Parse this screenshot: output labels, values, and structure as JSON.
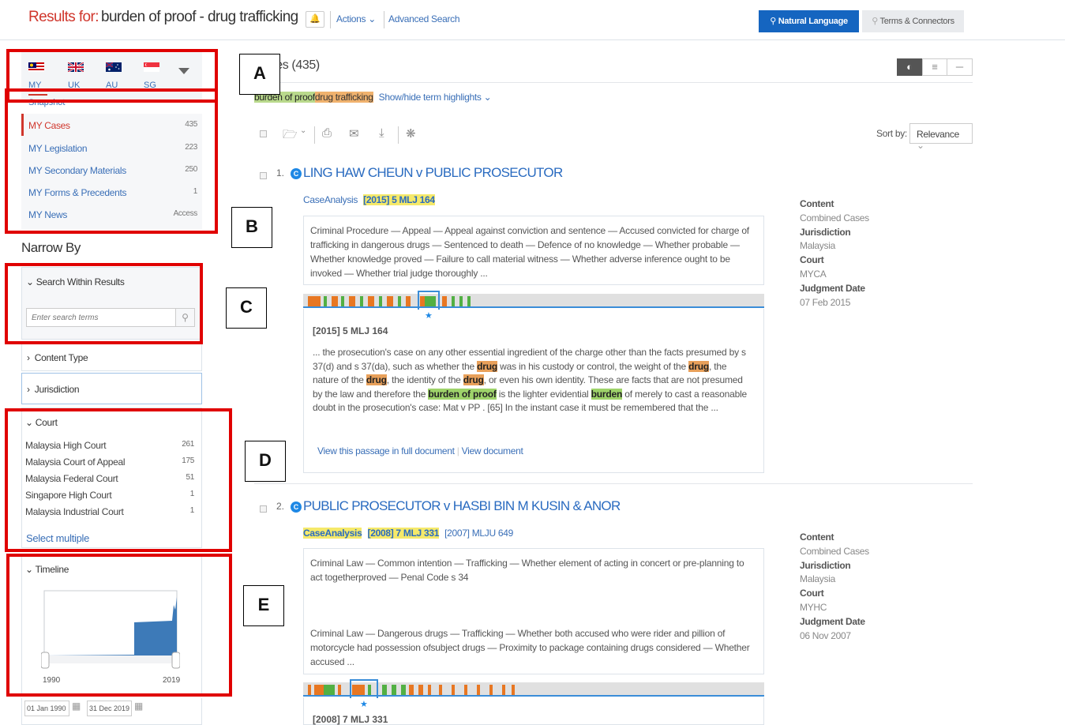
{
  "header": {
    "results_for_label": "Results for:",
    "query": "burden of proof - drug trafficking",
    "bell_icon": "bell-icon",
    "actions": "Actions",
    "advanced_search": "Advanced Search",
    "natural_language": "Natural Language",
    "terms_connectors": "Terms & Connectors"
  },
  "jurisdiction_tabs": [
    {
      "code": "MY",
      "flag": "malaysia-flag-icon"
    },
    {
      "code": "UK",
      "flag": "uk-flag-icon"
    },
    {
      "code": "AU",
      "flag": "australia-flag-icon"
    },
    {
      "code": "SG",
      "flag": "singapore-flag-icon"
    }
  ],
  "snapshot_label": "Snapshot",
  "content_counts": [
    {
      "label": "MY Cases",
      "count": "435",
      "active": true
    },
    {
      "label": "MY Legislation",
      "count": "223"
    },
    {
      "label": "MY Secondary Materials",
      "count": "250"
    },
    {
      "label": "MY Forms & Precedents",
      "count": "1"
    },
    {
      "label": "MY News",
      "count": "Access"
    }
  ],
  "narrow_by": "Narrow By",
  "search_within": {
    "title": "Search Within Results",
    "placeholder": "Enter search terms"
  },
  "content_type": "Content Type",
  "jurisdiction": "Jurisdiction",
  "court_facet": {
    "title": "Court",
    "items": [
      {
        "label": "Malaysia High Court",
        "count": "261"
      },
      {
        "label": "Malaysia Court of Appeal",
        "count": "175"
      },
      {
        "label": "Malaysia Federal Court",
        "count": "51"
      },
      {
        "label": "Singapore High Court",
        "count": "1"
      },
      {
        "label": "Malaysia Industrial Court",
        "count": "1"
      }
    ],
    "select_multiple": "Select multiple"
  },
  "timeline": {
    "title": "Timeline",
    "start_year": "1990",
    "end_year": "2019",
    "from_date": "01 Jan 1990",
    "to_date": "31 Dec 2019"
  },
  "overlay_labels": [
    "A",
    "B",
    "C",
    "D",
    "E"
  ],
  "results": {
    "heading": "Cases (435)",
    "terms": [
      "burden of proof",
      "drug trafficking"
    ],
    "show_hide": "Show/hide term highlights",
    "sort_by": "Sort by:",
    "sort_value": "Relevance",
    "items": [
      {
        "index": "1.",
        "title": "LING HAW CHEUN v PUBLIC PROSECUTOR",
        "case_analysis": "CaseAnalysis",
        "citation": "[2015] 5 MLJ 164",
        "summary": "Criminal Procedure — Appeal — Appeal against conviction and sentence — Accused convicted for charge of trafficking in dangerous drugs — Sentenced to death — Defence of no knowledge — Whether probable — Whether knowledge proved — Failure to call material witness — Whether adverse inference ought to be invoked — Whether trial judge thoroughly ...",
        "passage_citation": "[2015] 5 MLJ 164",
        "passage": [
          {
            "t": "... the prosecution's case on any other essential ingredient of the charge other than the facts presumed by s 37(d) and s 37(da), such as whether the "
          },
          {
            "t": "drug",
            "h": "o"
          },
          {
            "t": " was in his custody or control, the weight of the "
          },
          {
            "t": "drug",
            "h": "o"
          },
          {
            "t": ", the nature of the "
          },
          {
            "t": "drug",
            "h": "o"
          },
          {
            "t": ", the identity of the "
          },
          {
            "t": "drug",
            "h": "o"
          },
          {
            "t": ", or even his own identity. These are facts that are not presumed by the law and therefore the "
          },
          {
            "t": "burden of proof",
            "h": "g"
          },
          {
            "t": " is the lighter evidential "
          },
          {
            "t": "burden",
            "h": "g"
          },
          {
            "t": " of merely to cast a reasonable doubt in the prosecution's case: Mat v PP . [65] In the instant case it must be remembered that the ..."
          }
        ],
        "view_passage": "View this passage in full document",
        "view_document": "View document",
        "meta": {
          "content_label": "Content",
          "content": "Combined Cases",
          "jurisdiction_label": "Jurisdiction",
          "jurisdiction": "Malaysia",
          "court_label": "Court",
          "court": "MYCA",
          "date_label": "Judgment Date",
          "date": "07 Feb 2015"
        }
      },
      {
        "index": "2.",
        "title": "PUBLIC PROSECUTOR v HASBI BIN M KUSIN & ANOR",
        "case_analysis": "CaseAnalysis",
        "citation": "[2008] 7 MLJ 331",
        "citation2": "[2007] MLJU 649",
        "summary1": "Criminal Law — Common intention — Trafficking — Whether element of acting in concert or pre-planning to act togetherproved — Penal Code s 34",
        "summary2": "Criminal Law — Dangerous drugs — Trafficking — Whether both accused who were rider and pillion of motorcycle had possession ofsubject drugs — Proximity to package containing drugs considered — Whether accused ...",
        "passage_citation": "[2008] 7 MLJ 331",
        "meta": {
          "content_label": "Content",
          "content": "Combined Cases",
          "jurisdiction_label": "Jurisdiction",
          "jurisdiction": "Malaysia",
          "court_label": "Court",
          "court": "MYHC",
          "date_label": "Judgment Date",
          "date": "06 Nov 2007"
        }
      }
    ]
  },
  "colors": {
    "accent_red": "#d0362c",
    "link_blue": "#3a6fb7",
    "button_blue": "#1565c0",
    "annotation_red": "#e00000",
    "hit_orange": "#e87722",
    "hit_green": "#52b043",
    "timeline_blue": "#3d7ab8"
  }
}
